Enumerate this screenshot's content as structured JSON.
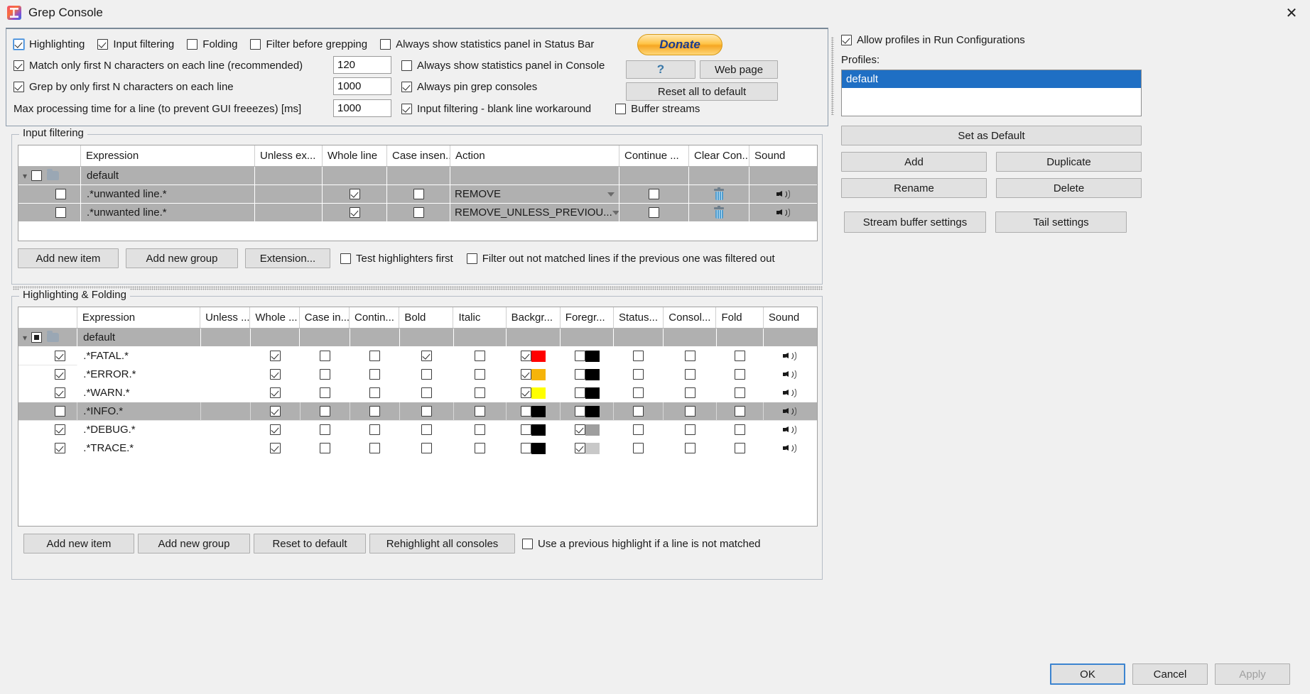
{
  "window": {
    "title": "Grep Console",
    "app_icon": "intellij-plugin-icon",
    "close_label": "✕"
  },
  "top_options": {
    "row1": [
      {
        "label": "Highlighting",
        "checked": true,
        "focused": true
      },
      {
        "label": "Input filtering",
        "checked": true,
        "focused": false
      },
      {
        "label": "Folding",
        "checked": false,
        "focused": false
      },
      {
        "label": "Filter before grepping",
        "checked": false,
        "focused": false
      },
      {
        "label": "Always show statistics panel in Status Bar",
        "checked": false,
        "focused": false
      }
    ],
    "row2": [
      {
        "label": "Match only first N characters on each line (recommended)",
        "checked": true
      },
      {
        "label": "Always show statistics panel in Console",
        "checked": false
      }
    ],
    "row3": [
      {
        "label": "Grep by only first N characters on each line",
        "checked": true
      },
      {
        "label": "Always pin grep consoles",
        "checked": true
      }
    ],
    "row4": [
      {
        "label": "Max processing time for a line (to prevent GUI freeezes) [ms]",
        "checked": null
      },
      {
        "label": "Input filtering - blank line workaround",
        "checked": true
      },
      {
        "label": "Buffer streams",
        "checked": false
      }
    ],
    "fields": {
      "match_first_n": "120",
      "grep_first_n": "1000",
      "max_processing_time": "1000"
    },
    "buttons": {
      "donate": "Donate",
      "help": "?",
      "web_page": "Web page",
      "reset_all": "Reset all to default"
    }
  },
  "input_filtering": {
    "group_label": "Input filtering",
    "columns": [
      "",
      "Expression",
      "Unless ex...",
      "Whole line",
      "Case insen..",
      "Action",
      "Continue ...",
      "Clear Con...",
      "Sound"
    ],
    "rows": [
      {
        "type": "group",
        "expanded": true,
        "checkbox": "unchecked",
        "expression": "default",
        "unless": "",
        "whole_line": null,
        "case_insensitive": null,
        "action": "",
        "continue": null,
        "clear_console": null,
        "sound": null
      },
      {
        "type": "item",
        "checkbox": "unchecked",
        "expression": ".*unwanted line.*",
        "unless": "",
        "whole_line": true,
        "case_insensitive": false,
        "action": "REMOVE",
        "continue": false,
        "clear_console": "trash-icon",
        "sound": "speaker-icon"
      },
      {
        "type": "item",
        "checkbox": "unchecked",
        "expression": ".*unwanted line.*",
        "unless": "",
        "whole_line": true,
        "case_insensitive": false,
        "action": "REMOVE_UNLESS_PREVIOU...",
        "continue": false,
        "clear_console": "trash-icon",
        "sound": "speaker-icon"
      }
    ],
    "buttons": [
      "Add new item",
      "Add new group",
      "Extension..."
    ],
    "checkboxes": [
      {
        "label": "Test highlighters first",
        "checked": false
      },
      {
        "label": "Filter out not matched lines if the previous one was filtered out",
        "checked": false
      }
    ]
  },
  "highlighting": {
    "group_label": "Highlighting & Folding",
    "columns": [
      "",
      "Expression",
      "Unless ...",
      "Whole ...",
      "Case in...",
      "Contin...",
      "Bold",
      "Italic",
      "Backgr...",
      "Foregr...",
      "Status...",
      "Consol...",
      "Fold",
      "Sound"
    ],
    "rows": [
      {
        "type": "group",
        "expanded": true,
        "checkbox": "partial",
        "expression": "default",
        "whole": null,
        "case": null,
        "contin": null,
        "bold": null,
        "italic": null,
        "background": null,
        "background_color": null,
        "foreground": null,
        "foreground_color": null,
        "status": null,
        "console": null,
        "fold": null,
        "sound": null,
        "selected": false
      },
      {
        "type": "item",
        "checkbox": "checked",
        "expression": ".*FATAL.*",
        "whole": true,
        "case": false,
        "contin": false,
        "bold": true,
        "italic": false,
        "background": true,
        "background_color": "#ff0000",
        "foreground": false,
        "foreground_color": "#000000",
        "status": false,
        "console": false,
        "fold": false,
        "sound": "speaker-icon",
        "selected": false
      },
      {
        "type": "item",
        "checkbox": "checked",
        "expression": ".*ERROR.*",
        "whole": true,
        "case": false,
        "contin": false,
        "bold": false,
        "italic": false,
        "background": true,
        "background_color": "#f5b40a",
        "foreground": false,
        "foreground_color": "#000000",
        "status": false,
        "console": false,
        "fold": false,
        "sound": "speaker-icon",
        "selected": false
      },
      {
        "type": "item",
        "checkbox": "checked",
        "expression": ".*WARN.*",
        "whole": true,
        "case": false,
        "contin": false,
        "bold": false,
        "italic": false,
        "background": true,
        "background_color": "#ffff00",
        "foreground": false,
        "foreground_color": "#000000",
        "status": false,
        "console": false,
        "fold": false,
        "sound": "speaker-icon",
        "selected": false
      },
      {
        "type": "item",
        "checkbox": "unchecked",
        "expression": ".*INFO.*",
        "whole": true,
        "case": false,
        "contin": false,
        "bold": false,
        "italic": false,
        "background": false,
        "background_color": "#000000",
        "foreground": false,
        "foreground_color": "#000000",
        "status": false,
        "console": false,
        "fold": false,
        "sound": "speaker-icon",
        "selected": true
      },
      {
        "type": "item",
        "checkbox": "checked",
        "expression": ".*DEBUG.*",
        "whole": true,
        "case": false,
        "contin": false,
        "bold": false,
        "italic": false,
        "background": false,
        "background_color": "#000000",
        "foreground": true,
        "foreground_color": "#9e9e9e",
        "status": false,
        "console": false,
        "fold": false,
        "sound": "speaker-icon",
        "selected": false
      },
      {
        "type": "item",
        "checkbox": "checked",
        "expression": ".*TRACE.*",
        "whole": true,
        "case": false,
        "contin": false,
        "bold": false,
        "italic": false,
        "background": false,
        "background_color": "#000000",
        "foreground": true,
        "foreground_color": "#c8c8c8",
        "status": false,
        "console": false,
        "fold": false,
        "sound": "speaker-icon",
        "selected": false
      }
    ],
    "buttons": [
      "Add new item",
      "Add new group",
      "Reset to default",
      "Rehighlight all consoles"
    ],
    "checkbox": {
      "label": "Use a previous highlight if a line is not matched",
      "checked": false
    }
  },
  "right_panel": {
    "allow_profiles": {
      "label": "Allow profiles in Run Configurations",
      "checked": true
    },
    "profiles_label": "Profiles:",
    "profiles": [
      {
        "name": "default",
        "selected": true
      }
    ],
    "buttons": {
      "set_as_default": "Set as Default",
      "add": "Add",
      "duplicate": "Duplicate",
      "rename": "Rename",
      "delete": "Delete",
      "stream_buffer_settings": "Stream buffer settings",
      "tail_settings": "Tail settings"
    }
  },
  "dialog_buttons": {
    "ok": "OK",
    "cancel": "Cancel",
    "apply": "Apply",
    "apply_disabled": true
  },
  "colors": {
    "accent": "#1f6fc4",
    "window_bg": "#f0f0f0",
    "row_shade": "#b0b0b0",
    "donate_bg": "#f5a623"
  }
}
